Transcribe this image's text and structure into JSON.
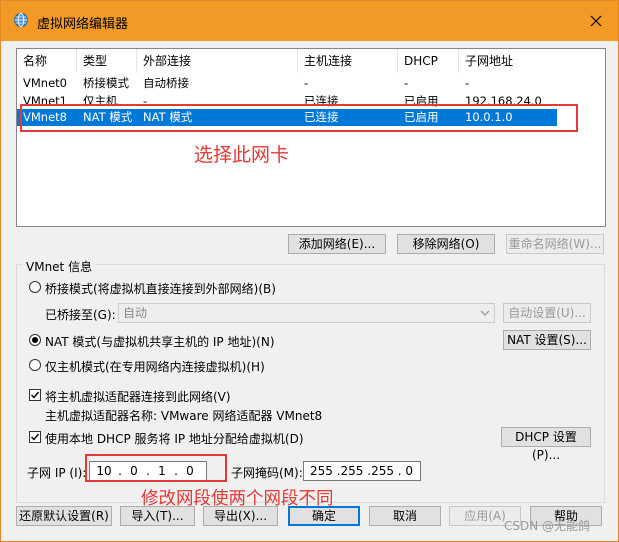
{
  "window": {
    "title": "虚拟网络编辑器",
    "close": "×"
  },
  "table": {
    "columns": [
      "名称",
      "类型",
      "外部连接",
      "主机连接",
      "DHCP",
      "子网地址"
    ],
    "rows": [
      {
        "name": "VMnet0",
        "type": "桥接模式",
        "ext": "自动桥接",
        "host": "-",
        "dhcp": "-",
        "subnet": "-"
      },
      {
        "name": "VMnet1",
        "type": "仅主机",
        "ext": "-",
        "host": "已连接",
        "dhcp": "已启用",
        "subnet": "192.168.24.0"
      },
      {
        "name": "VMnet8",
        "type": "NAT 模式",
        "ext": "NAT 模式",
        "host": "已连接",
        "dhcp": "已启用",
        "subnet": "10.0.1.0"
      }
    ],
    "selected_row": 2
  },
  "annotations": {
    "select_nic": "选择此网卡",
    "modify_segment": "修改网段使两个网段不同"
  },
  "actions": {
    "add_network": "添加网络(E)...",
    "remove_network": "移除网络(O)",
    "rename_network": "重命名网络(W)..."
  },
  "info": {
    "title": "VMnet 信息",
    "bridge_mode": "桥接模式(将虚拟机直接连接到外部网络)(B)",
    "bridged_to_label": "已桥接至(G):",
    "bridged_to_value": "自动",
    "auto_settings": "自动设置(U)...",
    "nat_mode": "NAT 模式(与虚拟机共享主机的 IP 地址)(N)",
    "nat_settings": "NAT 设置(S)...",
    "host_only": "仅主机模式(在专用网络内连接虚拟机)(H)",
    "connect_adapter": "将主机虚拟适配器连接到此网络(V)",
    "adapter_name": "主机虚拟适配器名称: VMware 网络适配器 VMnet8",
    "use_dhcp": "使用本地 DHCP 服务将 IP 地址分配给虚拟机(D)",
    "dhcp_settings": "DHCP 设置(P)...",
    "subnet_ip_label": "子网 IP (I):",
    "subnet_ip": [
      "10",
      "0",
      "1",
      "0"
    ],
    "ip_dot": ".",
    "subnet_mask_label": "子网掩码(M):",
    "subnet_mask": "255 .255 .255 . 0"
  },
  "footer": {
    "restore": "还原默认设置(R)",
    "import": "导入(T)...",
    "export": "导出(X)...",
    "ok": "确定",
    "cancel": "取消",
    "apply": "应用(A)",
    "help": "帮助"
  },
  "watermark": "CSDN @无能鸽",
  "colors": {
    "titlebar": "#f39a26",
    "selection": "#0078d7",
    "annotation": "#e53935"
  },
  "icons": {
    "app": "network-globe-icon",
    "close": "close-icon",
    "dropdown": "chevron-down-icon"
  }
}
